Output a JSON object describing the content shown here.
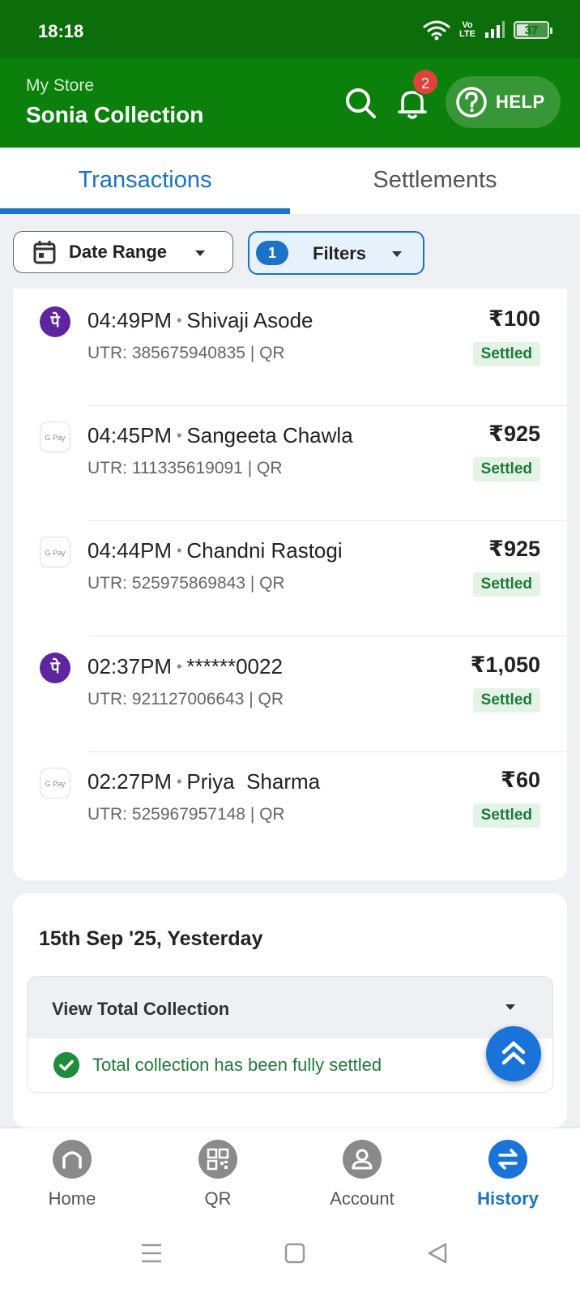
{
  "status_bar": {
    "time": "18:18",
    "network": "Vo LTE",
    "battery": "37"
  },
  "header": {
    "subtitle": "My Store",
    "store_name": "Sonia Collection",
    "notification_count": "2",
    "help_label": "HELP"
  },
  "tabs": [
    {
      "label": "Transactions",
      "active": true
    },
    {
      "label": "Settlements",
      "active": false
    }
  ],
  "filters": {
    "date_range_label": "Date Range",
    "filters_label": "Filters",
    "filters_count": "1"
  },
  "transactions": [
    {
      "app": "phonepe",
      "logo_text": "पे",
      "time": "04:49PM",
      "name": "Shivaji Asode",
      "utr": "UTR: 385675940835 | QR",
      "amount": "₹100",
      "status": "Settled"
    },
    {
      "app": "gpay",
      "logo_text": "G Pay",
      "time": "04:45PM",
      "name": "Sangeeta Chawla",
      "utr": "UTR: 111335619091 | QR",
      "amount": "₹925",
      "status": "Settled"
    },
    {
      "app": "gpay",
      "logo_text": "G Pay",
      "time": "04:44PM",
      "name": "Chandni Rastogi",
      "utr": "UTR: 525975869843 | QR",
      "amount": "₹925",
      "status": "Settled"
    },
    {
      "app": "phonepe",
      "logo_text": "पे",
      "time": "02:37PM",
      "name": "******0022",
      "utr": "UTR: 921127006643 | QR",
      "amount": "₹1,050",
      "status": "Settled"
    },
    {
      "app": "gpay",
      "logo_text": "G Pay",
      "time": "02:27PM",
      "name": "Priya  Sharma",
      "utr": "UTR: 525967957148 | QR",
      "amount": "₹60",
      "status": "Settled"
    }
  ],
  "yesterday": {
    "date_title": "15th Sep '25, Yesterday",
    "view_total_label": "View Total Collection",
    "settled_message": "Total collection has been fully settled"
  },
  "bottom_nav": [
    {
      "label": "Home",
      "active": false
    },
    {
      "label": "QR",
      "active": false
    },
    {
      "label": "Account",
      "active": false
    },
    {
      "label": "History",
      "active": true
    }
  ],
  "colors": {
    "header_green": "#0b800b",
    "accent_blue": "#1a73c6",
    "settled_green": "#1f7a3a",
    "phonepe_purple": "#5f259f"
  }
}
